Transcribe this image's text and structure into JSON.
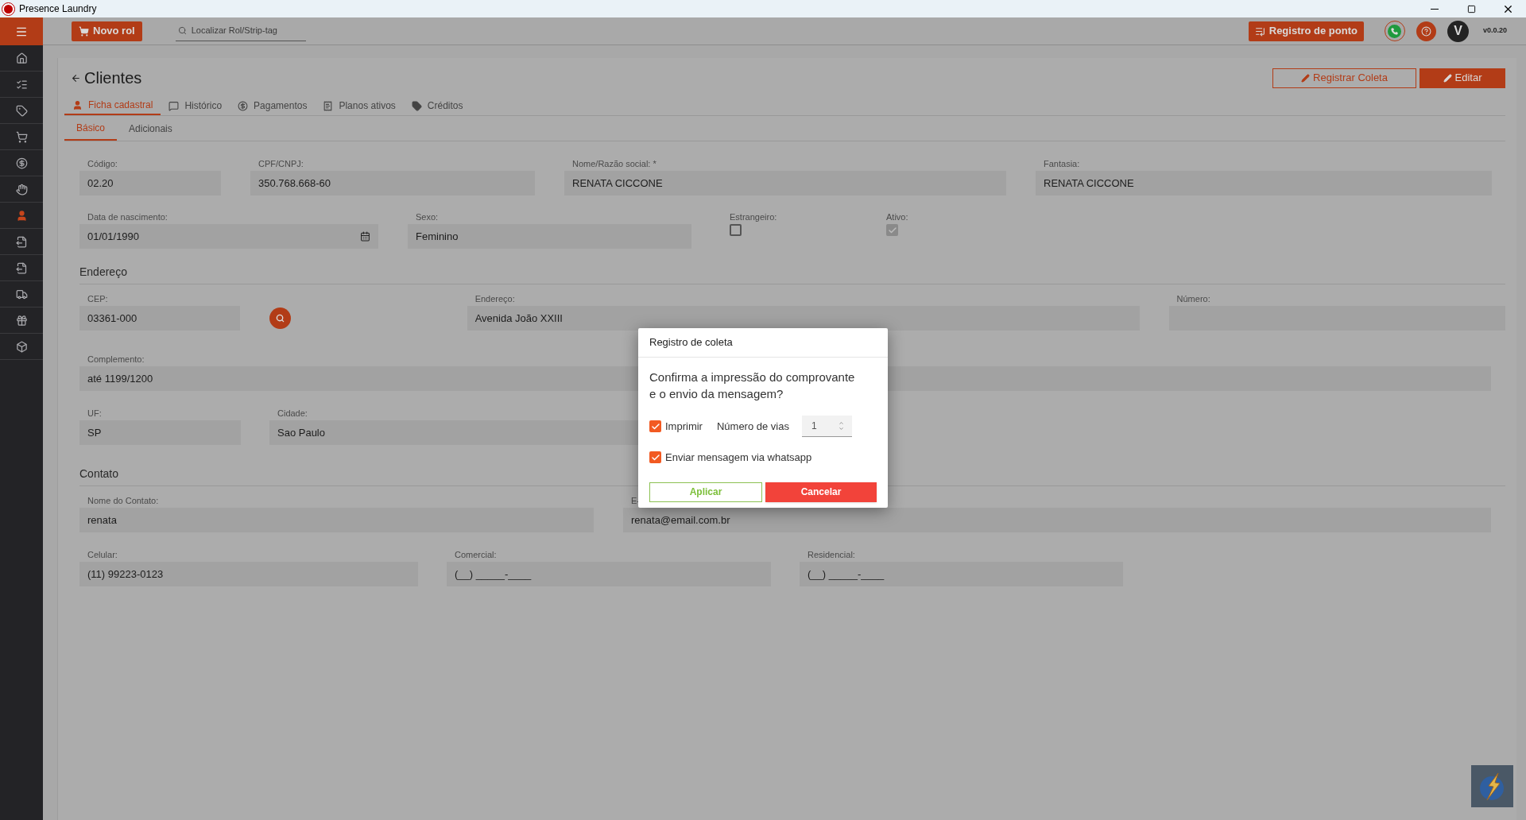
{
  "window": {
    "title": "Presence Laundry"
  },
  "sidebar": {
    "items": [
      {
        "selected": false
      },
      {
        "selected": false
      },
      {
        "selected": false
      },
      {
        "selected": false
      },
      {
        "selected": false
      },
      {
        "selected": false
      },
      {
        "selected": true
      },
      {
        "selected": false
      },
      {
        "selected": false
      },
      {
        "selected": false
      },
      {
        "selected": false
      },
      {
        "selected": false
      }
    ]
  },
  "topbar": {
    "new_button": "Novo rol",
    "search": {
      "placeholder": "Localizar Rol/Strip-tag"
    },
    "clock_button": "Registro de ponto",
    "avatar": "V",
    "version": "v0.0.20"
  },
  "page": {
    "title": "Clientes",
    "actions": [
      {
        "label": "Registrar Coleta",
        "kind": "outline"
      },
      {
        "label": "Editar",
        "kind": "solid"
      }
    ],
    "tabs": [
      {
        "label": "Ficha cadastral",
        "selected": true
      },
      {
        "label": "Histórico",
        "selected": false
      },
      {
        "label": "Pagamentos",
        "selected": false
      },
      {
        "label": "Planos ativos",
        "selected": false
      },
      {
        "label": "Créditos",
        "selected": false
      }
    ],
    "subtabs": [
      {
        "label": "Básico",
        "selected": true
      },
      {
        "label": "Adicionais",
        "selected": false
      }
    ]
  },
  "form": {
    "codigo": {
      "label": "Código:",
      "value": "02.20"
    },
    "cpf": {
      "label": "CPF/CNPJ:",
      "value": "350.768.668-60"
    },
    "nome": {
      "label": "Nome/Razão social: *",
      "value": "RENATA CICCONE"
    },
    "fantasia": {
      "label": "Fantasia:",
      "value": "RENATA CICCONE"
    },
    "nascimento": {
      "label": "Data de nascimento:",
      "value": "01/01/1990"
    },
    "sexo": {
      "label": "Sexo:",
      "value": "Feminino"
    },
    "estrangeiro": {
      "label": "Estrangeiro:",
      "checked": false
    },
    "ativo": {
      "label": "Ativo:",
      "checked": true,
      "disabled": true
    },
    "endereco_title": "Endereço",
    "cep": {
      "label": "CEP:",
      "value": "03361-000"
    },
    "endereco": {
      "label": "Endereço:",
      "value": "Avenida João XXIII"
    },
    "numero": {
      "label": "Número:"
    },
    "complemento": {
      "label": "Complemento:",
      "value": "até 1199/1200"
    },
    "uf": {
      "label": "UF:",
      "value": "SP"
    },
    "cidade": {
      "label": "Cidade:",
      "value": "Sao Paulo"
    },
    "contato_title": "Contato",
    "nome_contato": {
      "label": "Nome do Contato:",
      "value": "renata"
    },
    "email": {
      "label": "E-",
      "value": "renata@email.com.br"
    },
    "celular": {
      "label": "Celular:",
      "value": "(11) 99223-0123"
    },
    "comercial": {
      "label": "Comercial:",
      "value": "(__) _____-____"
    },
    "residencial": {
      "label": "Residencial:",
      "value": "(__) _____-____"
    }
  },
  "dialog": {
    "title": "Registro de coleta",
    "message": "Confirma a impressão do comprovante e o envio da mensagem?",
    "print": {
      "label": "Imprimir",
      "checked": true
    },
    "copies": {
      "label": "Número de vias",
      "value": "1"
    },
    "whatsapp": {
      "label": "Enviar mensagem via whatsapp",
      "checked": true
    },
    "apply": "Aplicar",
    "cancel": "Cancelar"
  }
}
